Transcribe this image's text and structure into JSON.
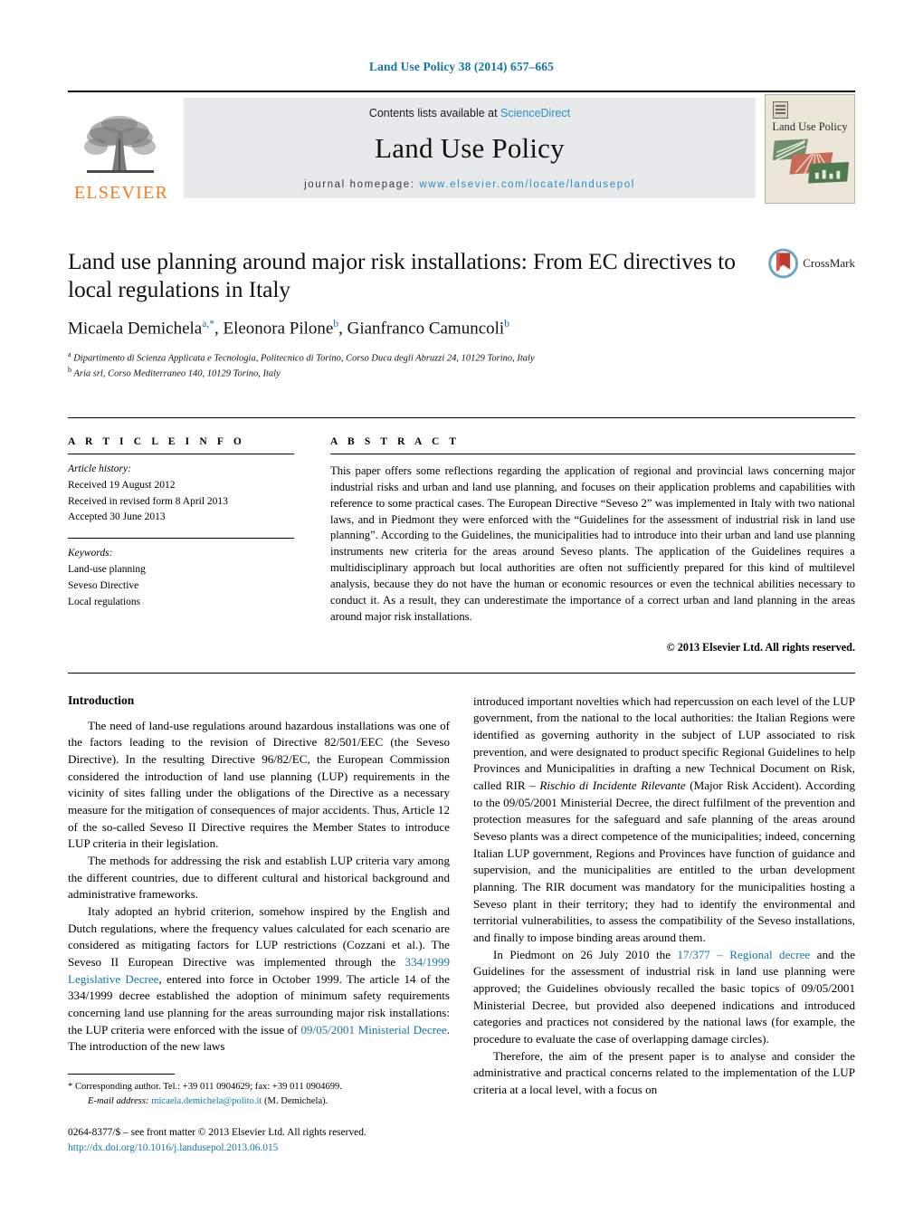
{
  "running_head": "Land Use Policy 38 (2014) 657–665",
  "masthead": {
    "publisher_name": "ELSEVIER",
    "contents_prefix": "Contents lists available at ",
    "contents_link": "ScienceDirect",
    "journal_title": "Land Use Policy",
    "homepage_prefix": "journal homepage: ",
    "homepage_url": "www.elsevier.com/locate/landusepol",
    "cover_title": "Land Use Policy"
  },
  "article": {
    "title": "Land use planning around major risk installations: From EC directives to local regulations in Italy",
    "authors_html": "Micaela Demichela<sup>a,*</sup>, Eleonora Pilone<sup>b</sup>, Gianfranco Camuncoli<sup>b</sup>",
    "affiliation_a": "Dipartimento di Scienza Applicata e Tecnologia, Politecnico di Torino, Corso Duca degli Abruzzi 24, 10129 Torino, Italy",
    "affiliation_b": "Aria srl, Corso Mediterraneo 140, 10129 Torino, Italy",
    "crossmark_label": "CrossMark"
  },
  "article_info": {
    "heading": "A R T I C L E    I N F O",
    "history_label": "Article history:",
    "history": [
      "Received 19 August 2012",
      "Received in revised form 8 April 2013",
      "Accepted 30 June 2013"
    ],
    "keywords_label": "Keywords:",
    "keywords": [
      "Land-use planning",
      "Seveso Directive",
      "Local regulations"
    ]
  },
  "abstract": {
    "heading": "A B S T R A C T",
    "text": "This paper offers some reflections regarding the application of regional and provincial laws concerning major industrial risks and urban and land use planning, and focuses on their application problems and capabilities with reference to some practical cases. The European Directive “Seveso 2” was implemented in Italy with two national laws, and in Piedmont they were enforced with the “Guidelines for the assessment of industrial risk in land use planning”. According to the Guidelines, the municipalities had to introduce into their urban and land use planning instruments new criteria for the areas around Seveso plants. The application of the Guidelines requires a multidisciplinary approach but local authorities are often not sufficiently prepared for this kind of multilevel analysis, because they do not have the human or economic resources or even the technical abilities necessary to conduct it. As a result, they can underestimate the importance of a correct urban and land planning in the areas around major risk installations.",
    "copyright": "© 2013 Elsevier Ltd. All rights reserved."
  },
  "body": {
    "section_heading": "Introduction",
    "left_paragraphs": [
      "The need of land-use regulations around hazardous installations was one of the factors leading to the revision of Directive 82/501/EEC (the Seveso Directive). In the resulting Directive 96/82/EC, the European Commission considered the introduction of land use planning (LUP) requirements in the vicinity of sites falling under the obligations of the Directive as a necessary measure for the mitigation of consequences of major accidents. Thus, Article 12 of the so-called Seveso II Directive requires the Member States to introduce LUP criteria in their legislation.",
      "The methods for addressing the risk and establish LUP criteria vary among the different countries, due to different cultural and historical background and administrative frameworks."
    ],
    "left_paragraph_3_pre": "Italy adopted an hybrid criterion, somehow inspired by the English and Dutch regulations, where the frequency values calculated for each scenario are considered as mitigating factors for LUP restrictions (Cozzani et al.). The Seveso II European Directive was implemented through the ",
    "left_link_1": "334/1999 Legislative Decree",
    "left_paragraph_3_mid": ", entered into force in October 1999. The article 14 of the 334/1999 decree established the adoption of minimum safety requirements concerning land use planning for the areas surrounding major risk installations: the LUP criteria were enforced with the issue of ",
    "left_link_2": "09/05/2001 Ministerial Decree",
    "left_paragraph_3_post": ". The introduction of the new laws",
    "right_paragraph_1_pre": "introduced important novelties which had repercussion on each level of the LUP government, from the national to the local authorities: the Italian Regions were identified as governing authority in the subject of LUP associated to risk prevention, and were designated to product specific Regional Guidelines to help Provinces and Municipalities in drafting a new Technical Document on Risk, called RIR – ",
    "right_italic_1": "Rischio di Incidente Rilevante",
    "right_paragraph_1_post": " (Major Risk Accident). According to the 09/05/2001 Ministerial Decree, the direct fulfilment of the prevention and protection measures for the safeguard and safe planning of the areas around Seveso plants was a direct competence of the municipalities; indeed, concerning Italian LUP government, Regions and Provinces have function of guidance and supervision, and the municipalities are entitled to the urban development planning. The RIR document was mandatory for the municipalities hosting a Seveso plant in their territory; they had to identify the environmental and territorial vulnerabilities, to assess the compatibility of the Seveso installations, and finally to impose binding areas around them.",
    "right_paragraph_2_pre": "In Piedmont on 26 July 2010 the ",
    "right_link_1": "17/377 – Regional decree",
    "right_paragraph_2_post": " and the Guidelines for the assessment of industrial risk in land use planning were approved; the Guidelines obviously recalled the basic topics of 09/05/2001 Ministerial Decree, but provided also deepened indications and introduced categories and practices not considered by the national laws (for example, the procedure to evaluate the case of overlapping damage circles).",
    "right_paragraph_3": "Therefore, the aim of the present paper is to analyse and consider the administrative and practical concerns related to the implementation of the LUP criteria at a local level, with a focus on"
  },
  "footnotes": {
    "corresponding": "* Corresponding author. Tel.: +39 011 0904629; fax: +39 011 0904699.",
    "email_label": "E-mail address:",
    "email": "micaela.demichela@polito.it",
    "email_suffix": "(M. Demichela).",
    "issn_line": "0264-8377/$ – see front matter © 2013 Elsevier Ltd. All rights reserved.",
    "doi": "http://dx.doi.org/10.1016/j.landusepol.2013.06.015"
  },
  "colors": {
    "link_blue": "#1277a8",
    "elsevier_orange": "#f47b20",
    "band_grey": "#e8e9eb",
    "cover_cream": "#ece6d9"
  }
}
